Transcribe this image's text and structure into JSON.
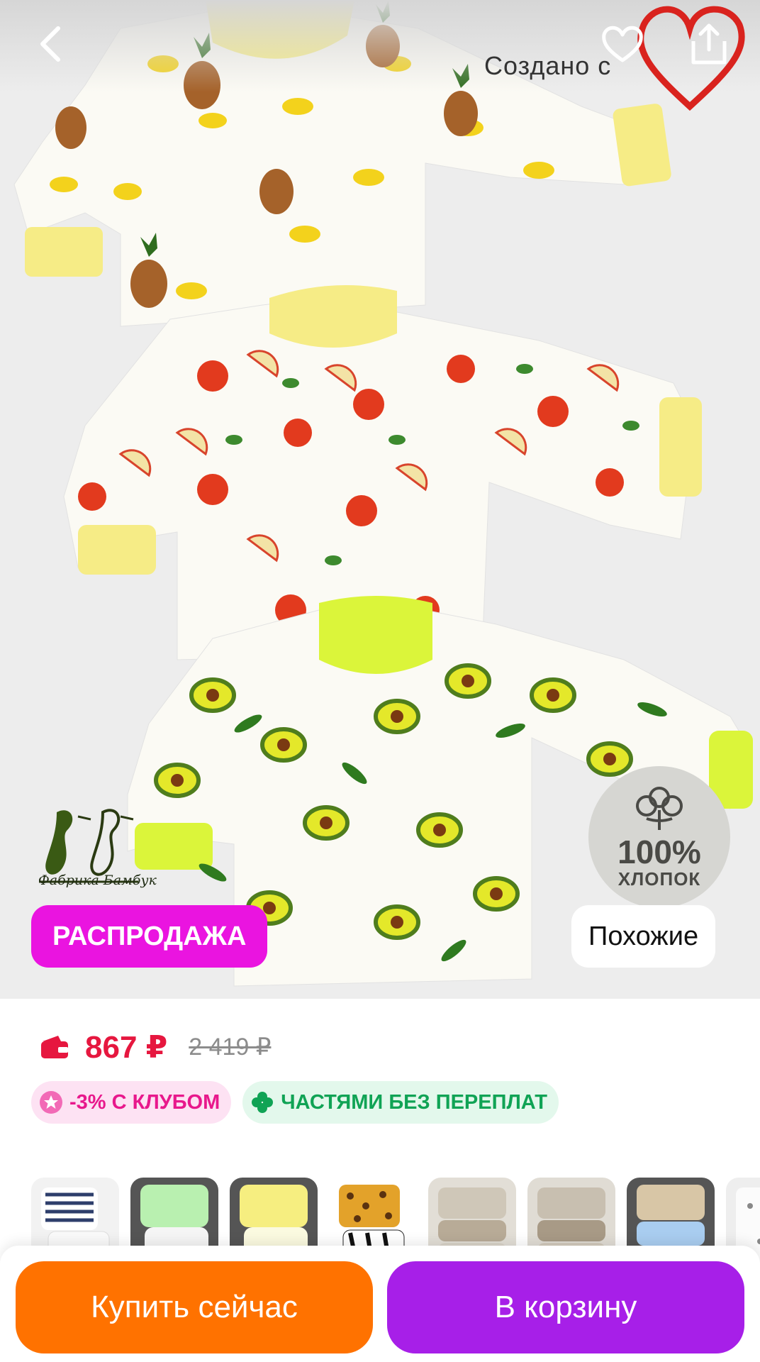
{
  "gallery": {
    "watermark": "Создано с",
    "brand_name": "Фабрика Бамбук",
    "cotton_percent": "100%",
    "cotton_word": "ХЛОПОК",
    "sale_label": "РАСПРОДАЖА",
    "similar_label": "Похожие"
  },
  "price": {
    "current": "867 ₽",
    "old": "2 419 ₽"
  },
  "promos": {
    "club": "-3% С КЛУБОМ",
    "installments": "ЧАСТЯМИ БЕЗ ПЕРЕПЛАТ"
  },
  "thumbnails": [
    {
      "name": "thumb-striped-set"
    },
    {
      "name": "thumb-mint-set"
    },
    {
      "name": "thumb-yellow-set"
    },
    {
      "name": "thumb-leopard-zebra-set"
    },
    {
      "name": "thumb-beige-set"
    },
    {
      "name": "thumb-taupe-set"
    },
    {
      "name": "thumb-blue-beige-set"
    },
    {
      "name": "thumb-white-print-set"
    }
  ],
  "actions": {
    "buy_now": "Купить сейчас",
    "add_to_cart": "В корзину"
  },
  "colors": {
    "sale": "#ea14e0",
    "price": "#e6173f",
    "buy": "#ff7200",
    "cart": "#a71fe8"
  },
  "icons": [
    "back-arrow-icon",
    "heart-icon",
    "share-icon",
    "wallet-icon",
    "star-badge-icon",
    "clover-icon"
  ]
}
